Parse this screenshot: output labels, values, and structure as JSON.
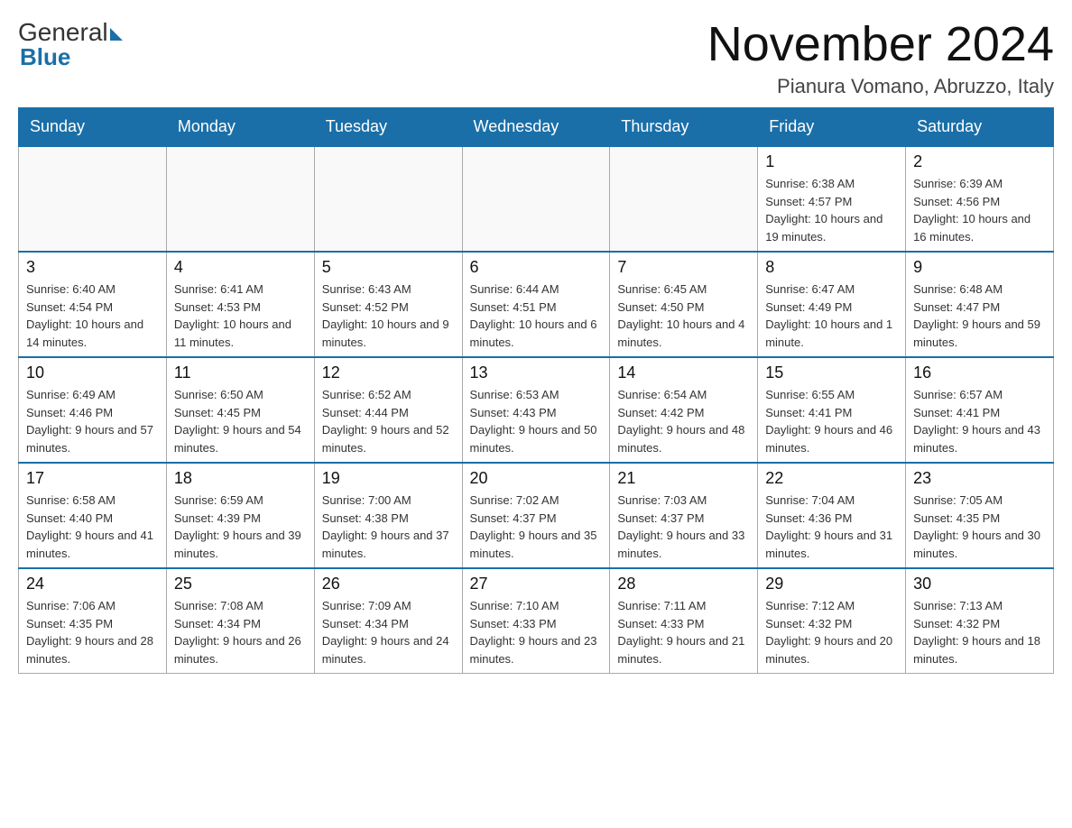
{
  "header": {
    "logo_general": "General",
    "logo_blue": "Blue",
    "month_title": "November 2024",
    "location": "Pianura Vomano, Abruzzo, Italy"
  },
  "days_of_week": [
    "Sunday",
    "Monday",
    "Tuesday",
    "Wednesday",
    "Thursday",
    "Friday",
    "Saturday"
  ],
  "weeks": [
    {
      "days": [
        {
          "number": "",
          "info": ""
        },
        {
          "number": "",
          "info": ""
        },
        {
          "number": "",
          "info": ""
        },
        {
          "number": "",
          "info": ""
        },
        {
          "number": "",
          "info": ""
        },
        {
          "number": "1",
          "info": "Sunrise: 6:38 AM\nSunset: 4:57 PM\nDaylight: 10 hours and 19 minutes."
        },
        {
          "number": "2",
          "info": "Sunrise: 6:39 AM\nSunset: 4:56 PM\nDaylight: 10 hours and 16 minutes."
        }
      ]
    },
    {
      "days": [
        {
          "number": "3",
          "info": "Sunrise: 6:40 AM\nSunset: 4:54 PM\nDaylight: 10 hours and 14 minutes."
        },
        {
          "number": "4",
          "info": "Sunrise: 6:41 AM\nSunset: 4:53 PM\nDaylight: 10 hours and 11 minutes."
        },
        {
          "number": "5",
          "info": "Sunrise: 6:43 AM\nSunset: 4:52 PM\nDaylight: 10 hours and 9 minutes."
        },
        {
          "number": "6",
          "info": "Sunrise: 6:44 AM\nSunset: 4:51 PM\nDaylight: 10 hours and 6 minutes."
        },
        {
          "number": "7",
          "info": "Sunrise: 6:45 AM\nSunset: 4:50 PM\nDaylight: 10 hours and 4 minutes."
        },
        {
          "number": "8",
          "info": "Sunrise: 6:47 AM\nSunset: 4:49 PM\nDaylight: 10 hours and 1 minute."
        },
        {
          "number": "9",
          "info": "Sunrise: 6:48 AM\nSunset: 4:47 PM\nDaylight: 9 hours and 59 minutes."
        }
      ]
    },
    {
      "days": [
        {
          "number": "10",
          "info": "Sunrise: 6:49 AM\nSunset: 4:46 PM\nDaylight: 9 hours and 57 minutes."
        },
        {
          "number": "11",
          "info": "Sunrise: 6:50 AM\nSunset: 4:45 PM\nDaylight: 9 hours and 54 minutes."
        },
        {
          "number": "12",
          "info": "Sunrise: 6:52 AM\nSunset: 4:44 PM\nDaylight: 9 hours and 52 minutes."
        },
        {
          "number": "13",
          "info": "Sunrise: 6:53 AM\nSunset: 4:43 PM\nDaylight: 9 hours and 50 minutes."
        },
        {
          "number": "14",
          "info": "Sunrise: 6:54 AM\nSunset: 4:42 PM\nDaylight: 9 hours and 48 minutes."
        },
        {
          "number": "15",
          "info": "Sunrise: 6:55 AM\nSunset: 4:41 PM\nDaylight: 9 hours and 46 minutes."
        },
        {
          "number": "16",
          "info": "Sunrise: 6:57 AM\nSunset: 4:41 PM\nDaylight: 9 hours and 43 minutes."
        }
      ]
    },
    {
      "days": [
        {
          "number": "17",
          "info": "Sunrise: 6:58 AM\nSunset: 4:40 PM\nDaylight: 9 hours and 41 minutes."
        },
        {
          "number": "18",
          "info": "Sunrise: 6:59 AM\nSunset: 4:39 PM\nDaylight: 9 hours and 39 minutes."
        },
        {
          "number": "19",
          "info": "Sunrise: 7:00 AM\nSunset: 4:38 PM\nDaylight: 9 hours and 37 minutes."
        },
        {
          "number": "20",
          "info": "Sunrise: 7:02 AM\nSunset: 4:37 PM\nDaylight: 9 hours and 35 minutes."
        },
        {
          "number": "21",
          "info": "Sunrise: 7:03 AM\nSunset: 4:37 PM\nDaylight: 9 hours and 33 minutes."
        },
        {
          "number": "22",
          "info": "Sunrise: 7:04 AM\nSunset: 4:36 PM\nDaylight: 9 hours and 31 minutes."
        },
        {
          "number": "23",
          "info": "Sunrise: 7:05 AM\nSunset: 4:35 PM\nDaylight: 9 hours and 30 minutes."
        }
      ]
    },
    {
      "days": [
        {
          "number": "24",
          "info": "Sunrise: 7:06 AM\nSunset: 4:35 PM\nDaylight: 9 hours and 28 minutes."
        },
        {
          "number": "25",
          "info": "Sunrise: 7:08 AM\nSunset: 4:34 PM\nDaylight: 9 hours and 26 minutes."
        },
        {
          "number": "26",
          "info": "Sunrise: 7:09 AM\nSunset: 4:34 PM\nDaylight: 9 hours and 24 minutes."
        },
        {
          "number": "27",
          "info": "Sunrise: 7:10 AM\nSunset: 4:33 PM\nDaylight: 9 hours and 23 minutes."
        },
        {
          "number": "28",
          "info": "Sunrise: 7:11 AM\nSunset: 4:33 PM\nDaylight: 9 hours and 21 minutes."
        },
        {
          "number": "29",
          "info": "Sunrise: 7:12 AM\nSunset: 4:32 PM\nDaylight: 9 hours and 20 minutes."
        },
        {
          "number": "30",
          "info": "Sunrise: 7:13 AM\nSunset: 4:32 PM\nDaylight: 9 hours and 18 minutes."
        }
      ]
    }
  ]
}
